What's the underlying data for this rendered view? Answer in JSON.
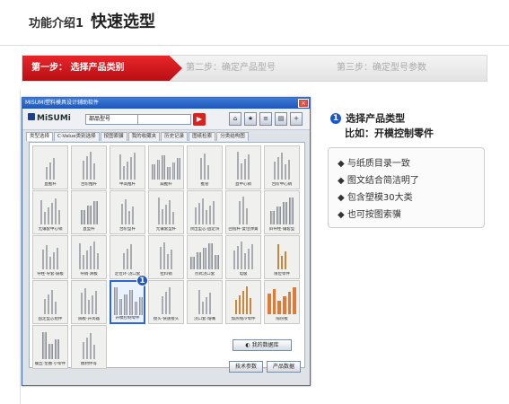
{
  "header": {
    "prefix": "功能介绍1",
    "title": "快速选型"
  },
  "steps": [
    {
      "label": "第一步： 选择产品类别",
      "active": true
    },
    {
      "label": "第二步：确定产品型号",
      "active": false
    },
    {
      "label": "第三步：确定型号参数",
      "active": false
    }
  ],
  "window": {
    "title": "MISUMi塑料模具设计辅助软件",
    "close": "×",
    "logo": "MiSUMi",
    "select_value": "部品型号",
    "go": "▶",
    "toolbar_icons": [
      "home-icon",
      "star-icon",
      "list-icon",
      "doc-icon",
      "plus-icon"
    ],
    "tabs": [
      "类型选择",
      "C-Value类别选择",
      "按图索骥",
      "我的收藏夹",
      "历史记录",
      "图纸检索",
      "分类结构图"
    ],
    "items": [
      "直推杆",
      "台阶推杆",
      "中高推杆",
      "扁推杆",
      "推管",
      "直中心销",
      "台阶中心销",
      "无镶套中心销",
      "直型杆",
      "台阶型杆",
      "无镶套型杆",
      "顶出型芯·固定块",
      "回程杆·复位弹簧",
      "斜导柱·镶套型",
      "导柱·导套·隔板",
      "导销·滑板",
      "定位环·浇口套",
      "拉料销",
      "点式浇口套",
      "电极",
      "限位零件",
      "固定型芯组件",
      "隔板·开闭器",
      "开模控制零件",
      "接头·快速接头",
      "浇口套·熔嘴",
      "加热线冷零件",
      "隔热板",
      "螺丝·垫圈·小零件",
      "模材件等"
    ],
    "highlight_label": "1",
    "db_button": "我的数据库",
    "btn_tech": "技术参数",
    "btn_prod": "产品数据"
  },
  "info": {
    "num": "1",
    "title": "选择产品类型",
    "subtitle": "比如：开模控制零件",
    "features": [
      "◆ 与纸质目录一致",
      "◆ 图文结合简洁明了",
      "◆ 包含塑模30大类",
      "◆ 也可按图索骥"
    ]
  }
}
